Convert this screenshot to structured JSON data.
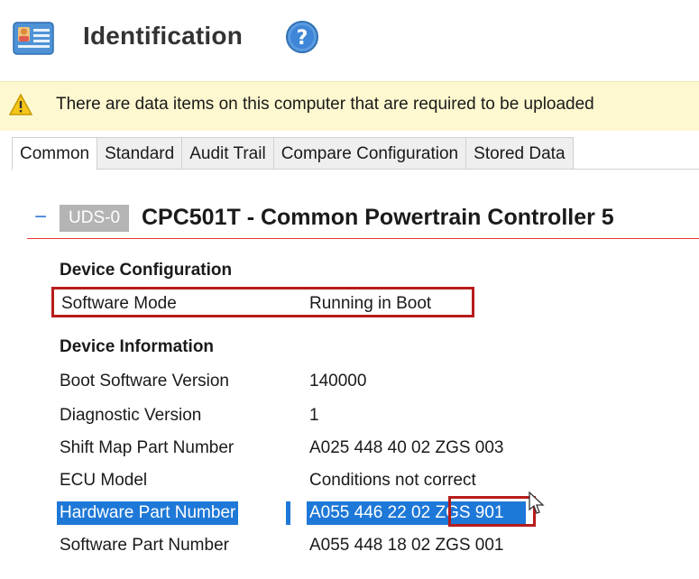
{
  "header": {
    "title": "Identification",
    "icon": "id-card-icon",
    "help_icon": "help-icon"
  },
  "warning": {
    "icon": "warning-icon",
    "text": "There are data items on this computer that are required to be uploaded"
  },
  "tabs": [
    {
      "label": "Common",
      "active": true
    },
    {
      "label": "Standard",
      "active": false
    },
    {
      "label": "Audit Trail",
      "active": false
    },
    {
      "label": "Compare Configuration",
      "active": false
    },
    {
      "label": "Stored Data",
      "active": false
    }
  ],
  "device": {
    "collapse_symbol": "−",
    "badge": "UDS-0",
    "title": "CPC501T - Common Powertrain Controller 5"
  },
  "device_configuration": {
    "heading": "Device Configuration",
    "rows": [
      {
        "label": "Software Mode",
        "value": "Running in Boot"
      }
    ]
  },
  "device_information": {
    "heading": "Device Information",
    "rows": [
      {
        "label": "Boot Software Version",
        "value": "140000"
      },
      {
        "label": "Diagnostic Version",
        "value": "1"
      },
      {
        "label": "Shift Map Part Number",
        "value": "A025 448 40 02 ZGS 003"
      },
      {
        "label": "ECU Model",
        "value": "Conditions not correct"
      },
      {
        "label": "Hardware Part Number",
        "value_prefix": "A055 446 22 02",
        "value_suffix": "ZGS 901",
        "selected": true
      },
      {
        "label": "Software Part Number",
        "value": "A055 448 18 02 ZGS 001"
      }
    ]
  },
  "colors": {
    "accent_blue": "#1e78d7",
    "highlight_red": "#b71c1c",
    "warning_bg": "#fdf8cf",
    "rule_red": "#e53935"
  }
}
